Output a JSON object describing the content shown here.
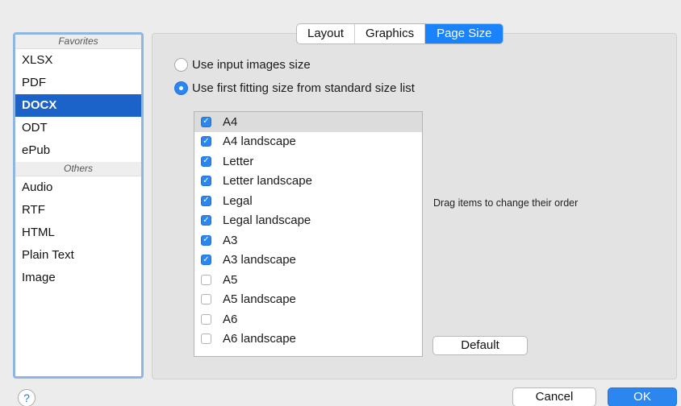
{
  "sidebar": {
    "groups": [
      {
        "label": "Favorites",
        "items": [
          "XLSX",
          "PDF",
          "DOCX",
          "ODT",
          "ePub"
        ]
      },
      {
        "label": "Others",
        "items": [
          "Audio",
          "RTF",
          "HTML",
          "Plain Text",
          "Image"
        ]
      }
    ],
    "selected": "DOCX"
  },
  "tabs": [
    "Layout",
    "Graphics",
    "Page Size"
  ],
  "active_tab": "Page Size",
  "options": {
    "use_input": "Use input images size",
    "use_first_fitting": "Use first fitting size from standard size list",
    "selected": "use_first_fitting"
  },
  "sizes": [
    {
      "label": "A4",
      "checked": true
    },
    {
      "label": "A4 landscape",
      "checked": true
    },
    {
      "label": "Letter",
      "checked": true
    },
    {
      "label": "Letter landscape",
      "checked": true
    },
    {
      "label": "Legal",
      "checked": true
    },
    {
      "label": "Legal landscape",
      "checked": true
    },
    {
      "label": "A3",
      "checked": true
    },
    {
      "label": "A3 landscape",
      "checked": true
    },
    {
      "label": "A5",
      "checked": false
    },
    {
      "label": "A5 landscape",
      "checked": false
    },
    {
      "label": "A6",
      "checked": false
    },
    {
      "label": "A6 landscape",
      "checked": false
    }
  ],
  "hint": "Drag items to change their order",
  "buttons": {
    "default": "Default",
    "cancel": "Cancel",
    "ok": "OK",
    "help": "?"
  },
  "colors": {
    "accent": "#2b86f0",
    "selection": "#1c63c9"
  },
  "icons": {
    "help": "question-mark-icon",
    "check": "checkmark-icon"
  }
}
